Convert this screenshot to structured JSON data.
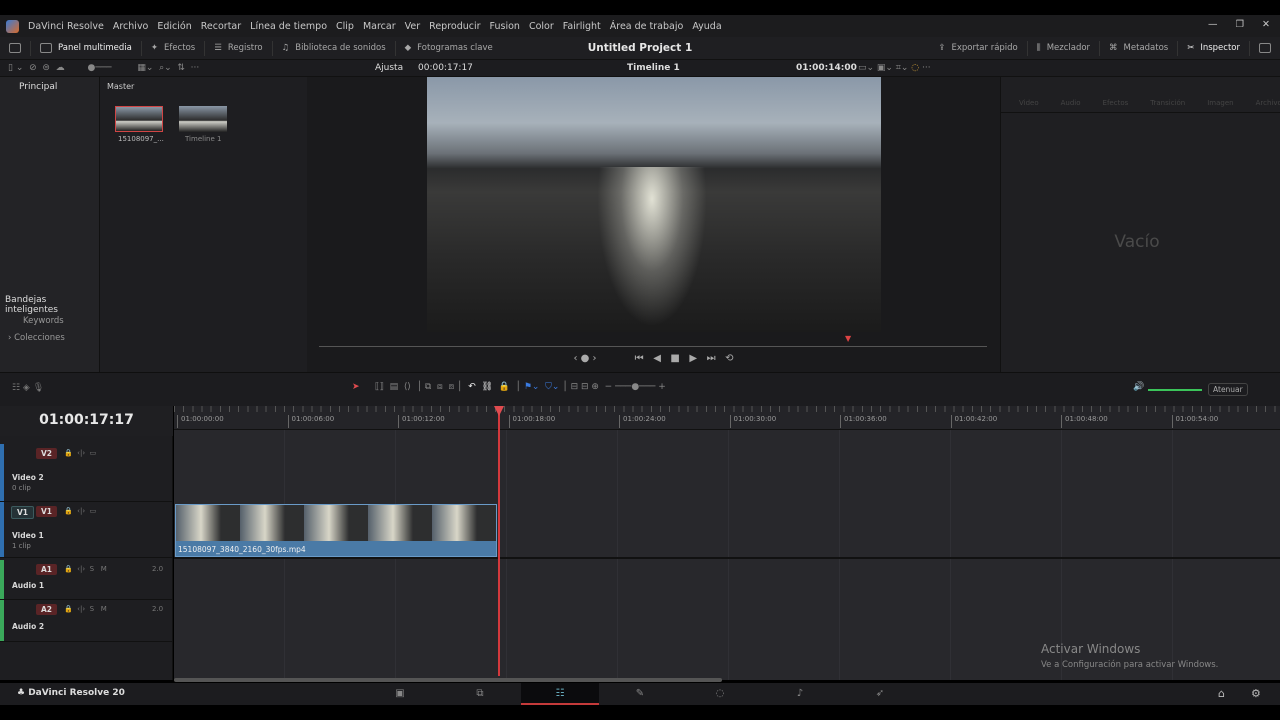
{
  "menu": {
    "app": "DaVinci Resolve",
    "items": [
      "Archivo",
      "Edición",
      "Recortar",
      "Línea de tiempo",
      "Clip",
      "Marcar",
      "Ver",
      "Reproducir",
      "Fusion",
      "Color",
      "Fairlight",
      "Área de trabajo",
      "Ayuda"
    ]
  },
  "toolbar": {
    "left": [
      "Panel multimedia",
      "Efectos",
      "Registro",
      "Biblioteca de sonidos",
      "Fotogramas clave"
    ],
    "title": "Untitled Project 1",
    "right": [
      "Exportar rápido",
      "Mezclador",
      "Metadatos",
      "Inspector"
    ]
  },
  "viewer": {
    "fit": "Ajusta",
    "source_tc": "00:00:17:17",
    "timeline_name": "Timeline 1",
    "timeline_tc": "01:00:14:00"
  },
  "mediapool": {
    "tabs": [
      "Principal",
      "Master"
    ],
    "smart_bins": "Bandejas inteligentes",
    "bins": [
      "Keywords",
      "Colecciones"
    ],
    "clips": [
      "15108097_...",
      "Timeline 1"
    ]
  },
  "inspector": {
    "tabs": [
      "Video",
      "Audio",
      "Efectos",
      "Transición",
      "Imagen",
      "Archivo"
    ],
    "empty": "Vacío"
  },
  "timeline": {
    "timecode": "01:00:17:17",
    "ruler": [
      "01:00:00:00",
      "01:00:06:00",
      "01:00:12:00",
      "01:00:18:00",
      "01:00:24:00",
      "01:00:30:00",
      "01:00:36:00",
      "01:00:42:00",
      "01:00:48:00",
      "01:00:54:00"
    ],
    "attenuate": "Atenuar",
    "tracks": [
      {
        "id": "V2",
        "name": "Video 2",
        "sub": "0 clip",
        "kind": "video"
      },
      {
        "id": "V1",
        "src": "V1",
        "name": "Video 1",
        "sub": "1 clip",
        "kind": "video"
      },
      {
        "id": "A1",
        "name": "Audio 1",
        "kind": "audio",
        "ch": "2.0",
        "s": "S",
        "m": "M"
      },
      {
        "id": "A2",
        "name": "Audio 2",
        "kind": "audio",
        "ch": "2.0",
        "s": "S",
        "m": "M"
      }
    ],
    "clip": "15108097_3840_2160_30fps.mp4"
  },
  "footer": {
    "brand": "DaVinci Resolve 20"
  },
  "watermark": {
    "title": "Activar Windows",
    "sub": "Ve a Configuración para activar Windows."
  }
}
